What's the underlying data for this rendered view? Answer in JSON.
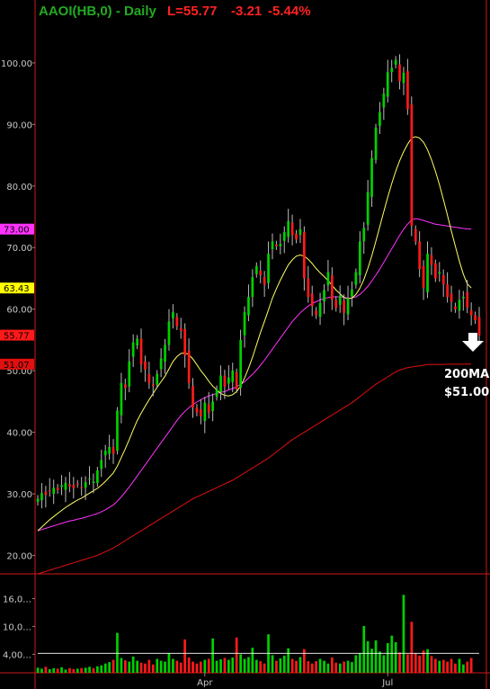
{
  "header": {
    "symbol": "AAOI(HB,0) - Daily",
    "last": "L=55.77",
    "change": "-3.21",
    "change_pct": "-5.44%"
  },
  "colors": {
    "background": "#000000",
    "up": "#00d000",
    "down": "#ff1a1a",
    "ma_yellow": "#ffff66",
    "ma_magenta": "#ff33ff",
    "ma_red": "#e01010",
    "axis": "#d01818",
    "text": "#c8c8c8",
    "header_green": "#22aa22",
    "header_red": "#ff2222"
  },
  "price_tags": [
    {
      "label": "73.00",
      "value": 73.0,
      "bg": "#ff33ff",
      "fg": "#000000"
    },
    {
      "label": "63.43",
      "value": 63.43,
      "bg": "#ffff00",
      "fg": "#000000"
    },
    {
      "label": "55.77",
      "value": 55.77,
      "bg": "#ff1a1a",
      "fg": "#000000"
    },
    {
      "label": "51.07",
      "value": 51.07,
      "bg": "#e01010",
      "fg": "#000000"
    }
  ],
  "annotation": {
    "line1": "200MA",
    "line2": "$51.00",
    "arrow": "down-arrow-icon"
  },
  "chart_data": [
    {
      "type": "candlestick",
      "title": "AAOI(HB,0) - Daily",
      "ylim": [
        17,
        107
      ],
      "y_ticks": [
        "100.00",
        "90.00",
        "80.00",
        "70.00",
        "60.00",
        "50.00",
        "40.00",
        "30.00",
        "20.00"
      ],
      "y_tick_values": [
        100,
        90,
        80,
        70,
        60,
        50,
        40,
        30,
        20
      ],
      "x_labels": [
        {
          "label": "Apr",
          "index": 42
        },
        {
          "label": "Jul",
          "index": 88
        }
      ],
      "close": [
        29.2,
        30.1,
        29.8,
        30.5,
        31.0,
        30.6,
        31.4,
        31.8,
        31.2,
        30.9,
        31.6,
        31.0,
        31.9,
        32.5,
        32.0,
        33.8,
        35.5,
        37.0,
        37.6,
        36.5,
        43.5,
        48.0,
        47.2,
        51.5,
        54.6,
        55.2,
        51.0,
        50.2,
        48.0,
        47.5,
        49.5,
        52.0,
        54.2,
        58.0,
        59.5,
        57.2,
        56.5,
        52.5,
        48.0,
        44.0,
        43.2,
        42.6,
        44.8,
        43.2,
        45.0,
        47.0,
        49.2,
        47.4,
        48.9,
        50.0,
        47.0,
        55.0,
        59.5,
        62.0,
        65.2,
        67.0,
        65.5,
        64.0,
        69.0,
        71.0,
        70.2,
        70.6,
        72.5,
        74.3,
        72.0,
        71.3,
        73.0,
        65.0,
        62.0,
        60.5,
        59.0,
        61.0,
        63.1,
        66.0,
        61.5,
        60.2,
        62.2,
        59.4,
        61.8,
        63.2,
        66.0,
        71.0,
        73.2,
        79.0,
        84.5,
        89.5,
        92.0,
        95.0,
        98.5,
        99.2,
        100.5,
        97.0,
        98.4,
        92.5,
        73.5,
        71.0,
        66.5,
        63.5,
        69.0,
        67.2,
        65.0,
        66.0,
        64.0,
        62.0,
        61.2,
        60.0,
        61.5,
        62.0,
        60.3,
        59.0,
        58.2,
        55.77
      ],
      "volume": [
        1.1,
        0.9,
        1.3,
        0.8,
        1.0,
        0.9,
        1.2,
        0.7,
        1.0,
        0.8,
        0.9,
        1.0,
        1.1,
        1.3,
        1.0,
        1.4,
        1.6,
        2.0,
        2.3,
        2.8,
        8.6,
        3.2,
        2.7,
        2.4,
        3.5,
        2.6,
        2.2,
        2.0,
        2.8,
        1.8,
        3.0,
        2.6,
        2.4,
        4.2,
        3.0,
        2.6,
        2.2,
        7.2,
        3.3,
        2.4,
        2.0,
        2.4,
        2.8,
        3.0,
        7.4,
        2.6,
        2.9,
        3.2,
        2.8,
        3.3,
        7.6,
        4.0,
        3.0,
        3.4,
        5.4,
        2.8,
        2.5,
        2.0,
        8.3,
        3.8,
        2.6,
        3.1,
        3.7,
        5.3,
        3.0,
        2.6,
        3.4,
        5.1,
        2.5,
        2.0,
        2.5,
        3.0,
        2.6,
        2.0,
        3.3,
        2.2,
        2.0,
        2.4,
        2.6,
        2.3,
        3.8,
        4.2,
        10.1,
        6.8,
        5.2,
        7.0,
        4.6,
        3.8,
        6.4,
        8.0,
        6.6,
        4.4,
        16.8,
        4.0,
        11.0,
        4.2,
        3.7,
        4.8,
        5.1,
        3.6,
        3.0,
        2.6,
        2.8,
        2.4,
        3.0,
        2.0,
        3.0,
        1.8,
        2.4,
        3.2
      ],
      "ma_yellow": [
        24.0,
        24.6,
        25.2,
        25.8,
        26.3,
        26.8,
        27.3,
        27.8,
        28.2,
        28.6,
        29.0,
        29.3,
        29.7,
        30.1,
        30.5,
        30.9,
        31.4,
        32.0,
        32.7,
        33.4,
        34.5,
        35.9,
        37.3,
        38.8,
        40.4,
        41.9,
        43.1,
        44.2,
        45.3,
        46.3,
        47.3,
        48.2,
        49.1,
        50.3,
        51.5,
        52.3,
        52.8,
        52.9,
        52.6,
        51.9,
        51.0,
        50.0,
        49.2,
        48.3,
        47.5,
        46.9,
        46.3,
        46.0,
        45.9,
        46.1,
        46.6,
        47.5,
        48.8,
        50.4,
        52.2,
        54.2,
        56.2,
        58.0,
        59.9,
        61.8,
        63.3,
        64.7,
        66.0,
        67.2,
        68.0,
        68.6,
        68.8,
        68.6,
        68.1,
        67.4,
        66.6,
        65.9,
        65.3,
        64.6,
        63.9,
        63.1,
        62.5,
        61.9,
        61.7,
        61.8,
        62.4,
        63.4,
        64.8,
        66.6,
        68.7,
        71.0,
        73.4,
        75.8,
        78.2,
        80.4,
        82.4,
        84.1,
        85.6,
        86.8,
        87.8,
        88.0,
        87.8,
        87.1,
        85.9,
        84.3,
        82.4,
        80.2,
        77.8,
        75.3,
        72.7,
        70.2,
        67.8,
        65.7,
        64.1,
        63.43
      ],
      "ma_magenta": [
        24.0,
        24.2,
        24.4,
        24.6,
        24.8,
        25.0,
        25.2,
        25.4,
        25.6,
        25.7,
        25.9,
        26.0,
        26.2,
        26.4,
        26.6,
        26.8,
        27.1,
        27.4,
        27.8,
        28.2,
        28.8,
        29.5,
        30.3,
        31.1,
        32.0,
        32.9,
        33.8,
        34.7,
        35.6,
        36.5,
        37.4,
        38.3,
        39.2,
        40.1,
        41.0,
        41.9,
        42.7,
        43.4,
        44.0,
        44.5,
        44.9,
        45.3,
        45.6,
        45.9,
        46.1,
        46.3,
        46.5,
        46.6,
        46.9,
        47.1,
        47.4,
        47.8,
        48.2,
        48.8,
        49.4,
        50.1,
        50.9,
        51.7,
        52.6,
        53.5,
        54.4,
        55.3,
        56.2,
        57.1,
        58.0,
        58.7,
        59.4,
        60.0,
        60.5,
        60.9,
        61.2,
        61.5,
        61.7,
        61.9,
        62.0,
        62.0,
        62.0,
        61.9,
        61.8,
        61.8,
        62.0,
        62.4,
        63.0,
        63.7,
        64.6,
        65.5,
        66.5,
        67.6,
        68.7,
        69.8,
        70.9,
        72.0,
        73.0,
        73.8,
        74.5,
        74.7,
        74.6,
        74.4,
        74.2,
        74.0,
        73.8,
        73.7,
        73.6,
        73.5,
        73.4,
        73.3,
        73.2,
        73.1,
        73.05,
        73.0
      ],
      "ma_red": [
        17.0,
        17.2,
        17.4,
        17.6,
        17.8,
        18.0,
        18.2,
        18.4,
        18.6,
        18.8,
        19.0,
        19.2,
        19.4,
        19.6,
        19.8,
        20.0,
        20.3,
        20.6,
        20.9,
        21.2,
        21.6,
        22.0,
        22.4,
        22.8,
        23.2,
        23.6,
        24.0,
        24.4,
        24.8,
        25.2,
        25.6,
        26.0,
        26.4,
        26.8,
        27.2,
        27.6,
        28.0,
        28.4,
        28.8,
        29.2,
        29.5,
        29.8,
        30.1,
        30.4,
        30.7,
        31.0,
        31.3,
        31.6,
        31.9,
        32.2,
        32.6,
        33.0,
        33.4,
        33.8,
        34.2,
        34.6,
        35.0,
        35.4,
        35.8,
        36.3,
        36.8,
        37.3,
        37.8,
        38.3,
        38.8,
        39.2,
        39.6,
        40.0,
        40.4,
        40.8,
        41.2,
        41.6,
        42.0,
        42.4,
        42.8,
        43.2,
        43.6,
        44.0,
        44.4,
        44.8,
        45.3,
        45.8,
        46.3,
        46.8,
        47.3,
        47.8,
        48.2,
        48.6,
        49.0,
        49.4,
        49.8,
        50.1,
        50.3,
        50.5,
        50.6,
        50.7,
        50.8,
        50.9,
        51.0,
        51.0,
        51.0,
        51.02,
        51.03,
        51.04,
        51.05,
        51.05,
        51.06,
        51.06,
        51.07,
        51.07
      ],
      "vol_ticks": [
        "16,0...",
        "10,0...",
        "4,00..."
      ],
      "vol_tick_values": [
        16,
        10,
        4
      ],
      "vol_ylim": [
        0,
        19
      ],
      "vol_ma": 4.2
    }
  ]
}
